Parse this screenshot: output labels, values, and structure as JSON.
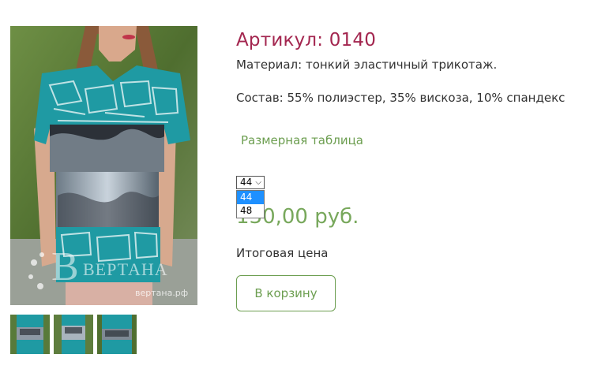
{
  "product": {
    "title": "Артикул: 0140",
    "material": "Материал: тонкий эластичный трикотаж.",
    "composition": "Состав: 55% полиэстер, 35% вискоза, 10% спандекс",
    "size_chart_link": "Размерная таблица",
    "size_select": {
      "selected": "44",
      "options": [
        "44",
        "48"
      ]
    },
    "price": "130,00 руб.",
    "total_label": "Итоговая цена",
    "add_to_cart": "В корзину"
  },
  "gallery": {
    "watermark_brand": "ВЕРТАНА",
    "watermark_url": "вертана.рф",
    "thumbnails": [
      "thumb-1",
      "thumb-2",
      "thumb-3"
    ]
  },
  "colors": {
    "title": "#a3264f",
    "accent_green": "#6c9e50",
    "price": "#78a85c",
    "select_highlight": "#1e90ff"
  }
}
